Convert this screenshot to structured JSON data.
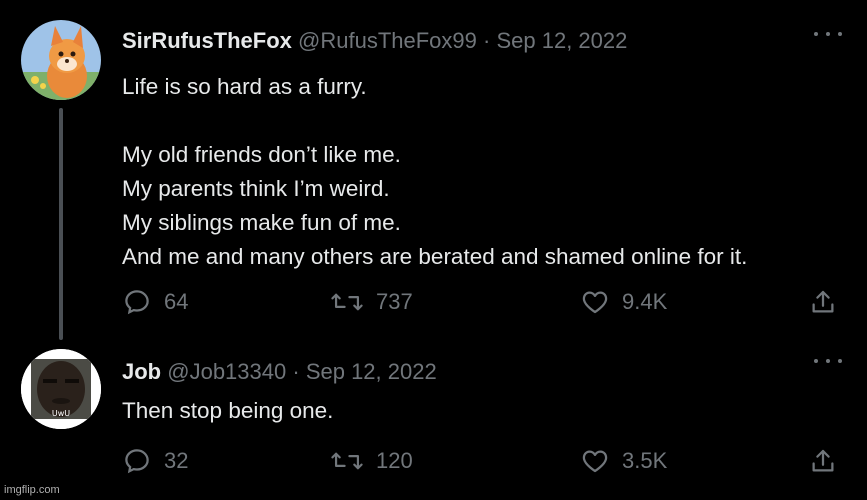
{
  "tweets": [
    {
      "display_name": "SirRufusTheFox",
      "handle": "@RufusTheFox99",
      "date": "Sep 12, 2022",
      "text": "Life is so hard as a furry.\n\nMy old friends don’t like me.\nMy parents think I’m weird.\nMy siblings make fun of me.\nAnd me and many others are berated and shamed online for it.",
      "replies": "64",
      "retweets": "737",
      "likes": "9.4K"
    },
    {
      "display_name": "Job",
      "handle": "@Job13340",
      "date": "Sep 12, 2022",
      "avatar_caption": "UwU",
      "text": "Then stop being one.",
      "replies": "32",
      "retweets": "120",
      "likes": "3.5K"
    }
  ],
  "separator": "·",
  "watermark": "imgflip.com",
  "colors": {
    "background": "#000000",
    "text": "#e7e9ea",
    "muted": "#71767b",
    "thread_line": "#4a4f54"
  },
  "icons": [
    "reply-icon",
    "retweet-icon",
    "like-icon",
    "share-icon",
    "more-icon"
  ]
}
